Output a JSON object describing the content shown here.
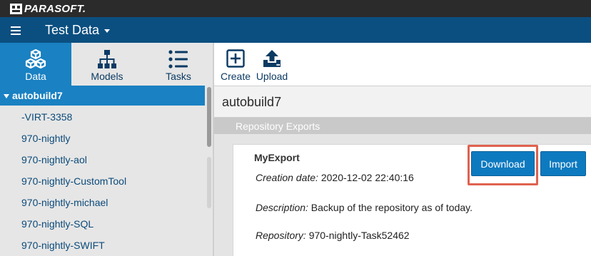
{
  "brand": {
    "name": "PARASOFT."
  },
  "header": {
    "title": "Test Data"
  },
  "nav_tabs": [
    {
      "label": "Data",
      "icon": "cubes-icon",
      "active": true
    },
    {
      "label": "Models",
      "icon": "hierarchy-icon",
      "active": false
    },
    {
      "label": "Tasks",
      "icon": "list-icon",
      "active": false
    }
  ],
  "toolbar": {
    "create_label": "Create",
    "upload_label": "Upload"
  },
  "tree": {
    "root": "autobuild7",
    "items": [
      "-VIRT-3358",
      "970-nightly",
      "970-nightly-aol",
      "970-nightly-CustomTool",
      "970-nightly-michael",
      "970-nightly-SQL",
      "970-nightly-SWIFT"
    ]
  },
  "main": {
    "title": "autobuild7",
    "section_header": "Repository Exports",
    "export": {
      "name": "MyExport",
      "creation_label": "Creation date:",
      "creation_value": " 2020-12-02 22:40:16",
      "description_label": "Description:",
      "description_value": " Backup of the repository as of today.",
      "repository_label": "Repository:",
      "repository_value": " 970-nightly-Task52462",
      "download_label": "Download",
      "import_label": "Import"
    }
  },
  "colors": {
    "brand_bar": "#2b2b2b",
    "app_bar": "#0b4f80",
    "accent": "#1a81c2",
    "button": "#0d7ac0",
    "highlight": "#e0624f"
  }
}
